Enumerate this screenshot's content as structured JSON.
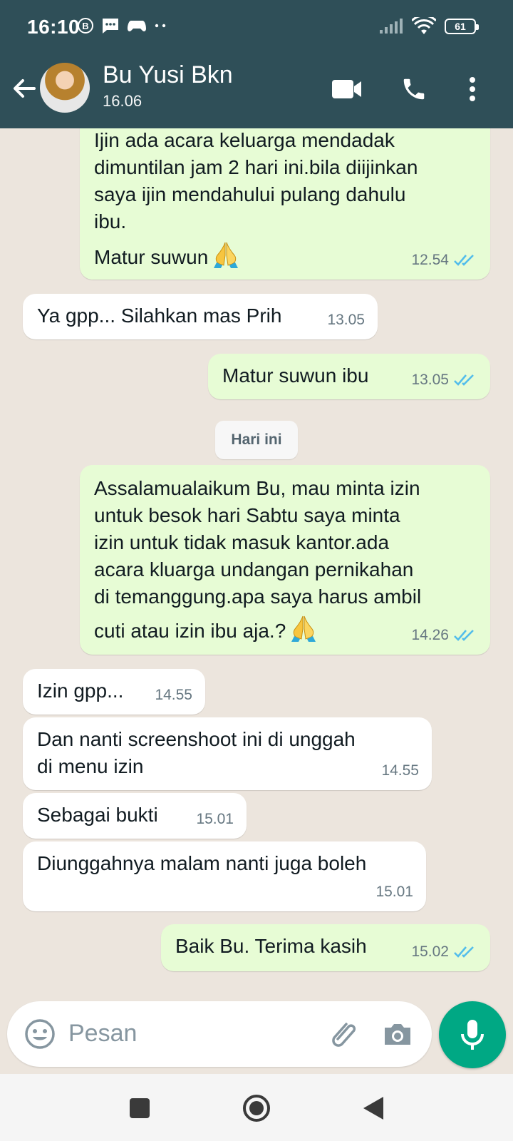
{
  "status_bar": {
    "time": "16:10",
    "battery": "61"
  },
  "header": {
    "contact_name": "Bu Yusi Bkn",
    "last_seen": "16.06"
  },
  "messages": [
    {
      "dir": "out",
      "text": "Ijin ada acara keluarga mendadak\ndimuntilan jam 2 hari ini.bila diijinkan\nsaya ijin mendahului pulang dahulu\nibu.",
      "text2": "Matur suwun",
      "time": "12.54",
      "read": true
    },
    {
      "dir": "in",
      "text": "Ya gpp... Silahkan mas Prih",
      "time": "13.05"
    },
    {
      "dir": "out",
      "text": "Matur suwun ibu",
      "time": "13.05",
      "read": true
    },
    {
      "dir": "out",
      "text": "Assalamualaikum Bu, mau minta izin\nuntuk besok hari Sabtu saya minta\nizin untuk tidak masuk kantor.ada\nacara kluarga undangan pernikahan\ndi temanggung.apa saya harus ambil",
      "text2": "cuti atau izin ibu aja.?",
      "time": "14.26",
      "read": true
    },
    {
      "dir": "in",
      "text": "Izin gpp...",
      "time": "14.55"
    },
    {
      "dir": "in",
      "text": "Dan nanti screenshoot ini di unggah\ndi menu izin",
      "time": "14.55"
    },
    {
      "dir": "in",
      "text": "Sebagai bukti",
      "time": "15.01"
    },
    {
      "dir": "in",
      "text": "Diunggahnya malam nanti juga boleh",
      "time": "15.01"
    },
    {
      "dir": "out",
      "text": "Baik Bu. Terima kasih",
      "time": "15.02",
      "read": true
    }
  ],
  "date_divider": "Hari ini",
  "composer": {
    "placeholder": "Pesan"
  },
  "colors": {
    "header": "#2f4f58",
    "outgoing": "#e7fcd5",
    "incoming": "#ffffff",
    "read_ticks": "#53bdeb",
    "mic": "#00a884"
  },
  "icons": [
    "arrow-back-icon",
    "video-call-icon",
    "phone-icon",
    "more-vert-icon",
    "emoji-icon",
    "attach-icon",
    "camera-icon",
    "mic-icon",
    "double-check-icon",
    "folded-hands-emoji"
  ]
}
